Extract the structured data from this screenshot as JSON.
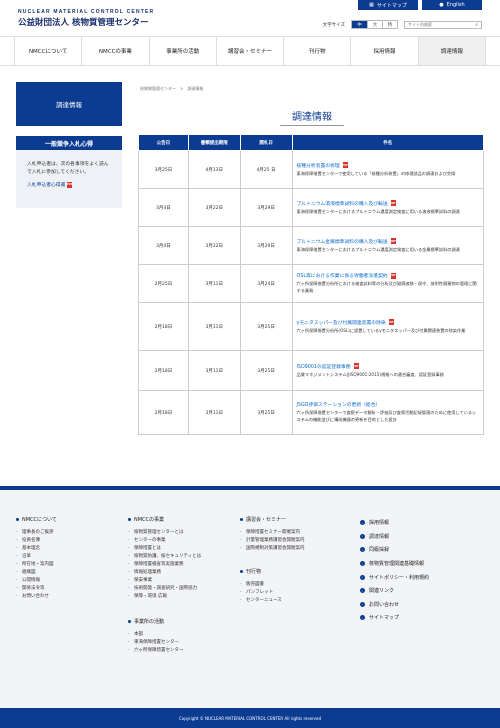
{
  "header": {
    "logo_en": "NUCLEAR MATERIAL CONTROL CENTER",
    "logo_ja": "公益財団法人 核物質管理センター",
    "sitemap": "サイトマップ",
    "english": "English",
    "font_size_label": "文字サイズ",
    "font_sizes": [
      "中",
      "大",
      "特"
    ],
    "search_placeholder": "サイト内検索"
  },
  "nav": [
    "NMCCについて",
    "NMCCの事業",
    "事業所の活動",
    "講習会・セミナー",
    "刊行物",
    "採用情報",
    "調達情報"
  ],
  "sidebar": {
    "heading": "調達情報",
    "box_title": "一般競争入札心得",
    "box_text": "入札申込者は、次の各事項をよく読んで入札に参加してください。",
    "box_link": "入札申込者心得書"
  },
  "breadcrumb": [
    "核物質管理センター",
    ">",
    "調達情報"
  ],
  "page_title": "調達情報",
  "table": {
    "headers": [
      "公告日",
      "書類提出期限",
      "開札日",
      "件名"
    ],
    "rows": [
      {
        "pub": "3月25日",
        "deadline": "4月13日",
        "open": "4月25 日",
        "title": "核種分析装置の修理",
        "desc": "東海保障措置センターで使用している「核種分析装置」の修理部品の調達および交換"
      },
      {
        "pub": "3月4日",
        "deadline": "3月22日",
        "open": "3月29日",
        "title": "プルトニウム溶液標準試料の購入及び輸送",
        "desc": "東海保障措置センターにおけるプルトニウム濃度測定検査に用いる溶液標準試料の調達"
      },
      {
        "pub": "3月4日",
        "deadline": "3月22日",
        "open": "3月29日",
        "title": "プルトニウム金属標準試料の購入及び輸送",
        "desc": "東海保障措置センターにおけるプルトニウム濃度測定検査に用いる金属標準試料の調達"
      },
      {
        "pub": "2月25日",
        "deadline": "3月11日",
        "open": "3月24日",
        "title": "OSL等における作業に係る労働者派遣契約",
        "desc": "六ヶ所保障措置分析所における検査試料等の分析及び副廃液移・保守、放射性廃棄物の管理に関する業務"
      },
      {
        "pub": "2月18日",
        "deadline": "3月11日",
        "open": "3月25日",
        "title": "γモニタスッパー及び付属関連装置の除染",
        "desc": "六ヶ所保障措置分析所(OSL)に設置しているγモニタスッパー及び付属関連装置の除染作業"
      },
      {
        "pub": "2月18日",
        "deadline": "3月11日",
        "open": "3月25日",
        "title": "ISO9001の認証登録事務",
        "desc": "品質マネジメントシステム(JISQ9001:2015)規格への適合審査、認証登録事務"
      },
      {
        "pub": "2月18日",
        "deadline": "3月11日",
        "open": "3月25日",
        "title": "JSGO評価ステーションの更新（総合）",
        "desc": "六ヶ所保障措置センターで査察データ解析・評価及び査察活動記録管理のために使用しているシステムの機能並びに構成機器の更新を目的とした設計"
      }
    ]
  },
  "footer": {
    "col1": {
      "head": "NMCCについて",
      "items": [
        "理事長のご挨拶",
        "役員名簿",
        "基本理念",
        "沿革",
        "所在地・案内図",
        "組織図",
        "公開情報",
        "関係法令等",
        "お問い合わせ"
      ]
    },
    "col2": {
      "head": "NMCCの事業",
      "items": [
        "核物質管理センターとは",
        "センターの事業",
        "保障措置とは",
        "核物質防護、核セキュリティとは",
        "保障措置検査等実施業務",
        "情報処理業務",
        "保安事業",
        "技術開発・調査研究・国際協力",
        "保障・環境 広報"
      ]
    },
    "col3": {
      "head": "講習会・セミナー",
      "items": [
        "保障措置セミナー開催案内",
        "計量管理業務講習会開催案内",
        "国際規制対策講習会開催案内"
      ]
    },
    "col4": {
      "head": "刊行物",
      "items": [
        "販売図書",
        "パンフレット",
        "センターニュース"
      ]
    },
    "col5": {
      "head": "事業所の活動",
      "items": [
        "本部",
        "東海保障措置センター",
        "六ヶ所保障措置センター"
      ]
    },
    "right": [
      "採用情報",
      "調達情報",
      "同級採録",
      "核物質管理関連基礎情報",
      "サイトポリシー・利用規約",
      "関連リンク",
      "お問い合わせ",
      "サイトマップ"
    ],
    "copyright": "Copyright © NUCLEAR MATERIAL CONTROL CENTER All rights reserved"
  }
}
